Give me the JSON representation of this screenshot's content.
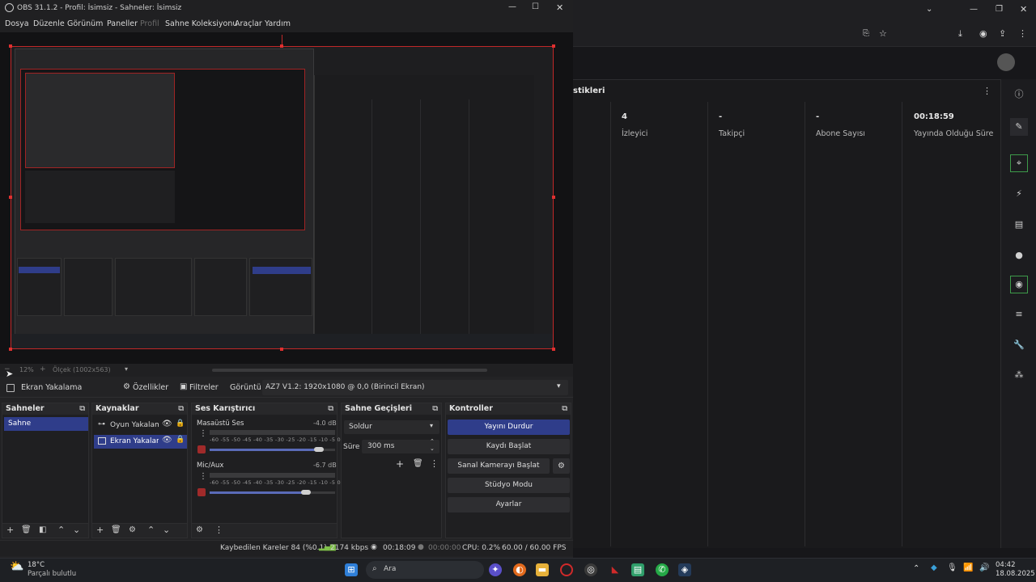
{
  "browser": {
    "section_title": "stikleri",
    "stats": [
      {
        "value": "4",
        "label": "İzleyici"
      },
      {
        "value": "-",
        "label": "Takipçi"
      },
      {
        "value": "-",
        "label": "Abone Sayısı"
      },
      {
        "value": "00:18:59",
        "label": "Yayında Olduğu Süre"
      }
    ]
  },
  "obs": {
    "title": "OBS 31.1.2 - Profil: İsimsiz - Sahneler: İsimsiz",
    "menu": [
      "Dosya",
      "Düzenle",
      "Görünüm",
      "Paneller",
      "Profil",
      "Sahne Koleksiyonu",
      "Araçlar",
      "Yardım"
    ],
    "zoom": {
      "percent": "12%",
      "scale": "Ölçek (1002x563)"
    },
    "source_bar": {
      "source_name": "Ekran Yakalama",
      "properties": "Özellikler",
      "filters": "Filtreler",
      "display_label": "Görüntü",
      "display_value": "AZ7 V1.2: 1920x1080 @ 0,0 (Birincil Ekran)"
    },
    "scenes": {
      "title": "Sahneler",
      "items": [
        "Sahne"
      ]
    },
    "sources": {
      "title": "Kaynaklar",
      "items": [
        "Oyun Yakalama",
        "Ekran Yakalama"
      ]
    },
    "mixer": {
      "title": "Ses Karıştırıcı",
      "channels": [
        {
          "name": "Masaüstü Ses",
          "db": "-4.0 dB",
          "level": 0.87
        },
        {
          "name": "Mic/Aux",
          "db": "-6.7 dB",
          "level": 0.77
        }
      ],
      "ticks": "-60 -55 -50 -45 -40 -35 -30 -25 -20 -15 -10 -5 0"
    },
    "transitions": {
      "title": "Sahne Geçişleri",
      "type": "Soldur",
      "duration_label": "Süre",
      "duration": "300 ms"
    },
    "controls": {
      "title": "Kontroller",
      "buttons": [
        "Yayını Durdur",
        "Kaydı Başlat",
        "Sanal Kamerayı Başlat",
        "Stüdyo Modu",
        "Ayarlar"
      ]
    },
    "status": {
      "dropped": "Kaybedilen Kareler 84 (%0.1)",
      "bitrate": "2174 kbps",
      "stream_time": "00:18:09",
      "rec_time": "00:00:00",
      "cpu": "CPU: 0.2%",
      "fps": "60.00 / 60.00 FPS"
    }
  },
  "taskbar": {
    "weather_temp": "18°C",
    "weather_desc": "Parçalı bulutlu",
    "search": "Ara",
    "time": "04:42",
    "date": "18.08.2025"
  },
  "colors": {
    "accent": "#2f3d8a",
    "selection_border": "#c02828",
    "highlight_green": "#3d9a4a"
  }
}
